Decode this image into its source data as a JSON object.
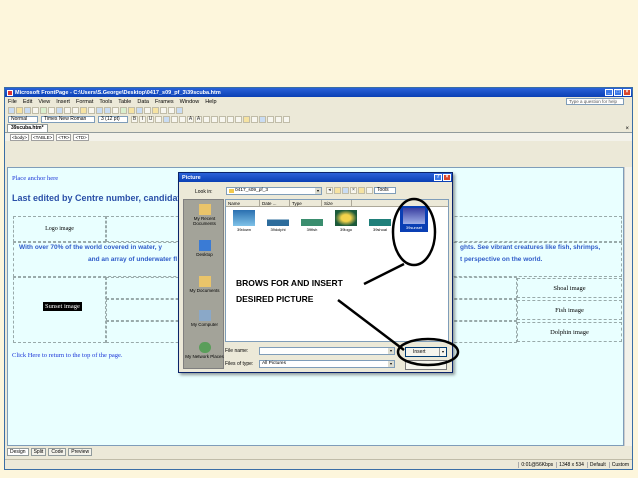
{
  "window": {
    "title": "Microsoft FrontPage - C:\\Users\\S.George\\Desktop\\0417_s09_pf_3\\39scuba.htm"
  },
  "menu": {
    "items": [
      "File",
      "Edit",
      "View",
      "Insert",
      "Format",
      "Tools",
      "Table",
      "Data",
      "Frames",
      "Window",
      "Help"
    ],
    "help_placeholder": "Type a question for help"
  },
  "format_toolbar": {
    "style": "Normal",
    "font": "Times New Roman",
    "size": "3 (12 pt)"
  },
  "document": {
    "tab": "39scuba.htm*",
    "tags": [
      "<body>",
      "<TABLE>",
      "<TR>",
      "<TD>"
    ]
  },
  "page": {
    "anchor_text": "Place anchor here",
    "last_edited": "Last edited by Centre number, candidat",
    "logo_cell": "Logo image",
    "intro_left_1": "With over 70% of the world covered in water, y",
    "intro_left_2": "and an array of underwater fl",
    "intro_right_1": "ghts. See vibrant creatures like fish, shrimps,",
    "intro_right_2": "t perspective on the world.",
    "sunset_cell": "Sunset image",
    "right_cells": [
      "Shoal image",
      "Fish image",
      "Dolphin image"
    ],
    "return_link": "Click Here to return to the top of the page."
  },
  "view_tabs": [
    "Design",
    "Split",
    "Code",
    "Preview"
  ],
  "status": {
    "download": "0:01@56Kbps",
    "dimensions": "1348 x 534",
    "mode": "Default",
    "custom": "Custom"
  },
  "dialog": {
    "title": "Picture",
    "look_in_label": "Look in:",
    "look_in_value": "0417_s09_pf_3",
    "tools_label": "Tools",
    "columns": [
      "Name",
      "Date ...",
      "Type",
      "Size"
    ],
    "places": [
      "My Recent Documents",
      "Desktop",
      "My Documents",
      "My Computer",
      "My Network Places"
    ],
    "files": [
      "39down",
      "39dolphi",
      "39fish",
      "39logo",
      "39shoal",
      "39sunset"
    ],
    "file_name_label": "File name:",
    "file_type_label": "Files of type:",
    "file_type_value": "All Pictures",
    "insert_label": "Insert"
  },
  "annotation": {
    "line1": "BROWS FOR AND INSERT",
    "line2": "DESIRED PICTURE"
  },
  "colors": {
    "title_bar": "#0a3fb4",
    "editor_bg": "#e9ffff",
    "slide_bg": "#fdf6dc",
    "heading_text": "#2a50a8"
  }
}
